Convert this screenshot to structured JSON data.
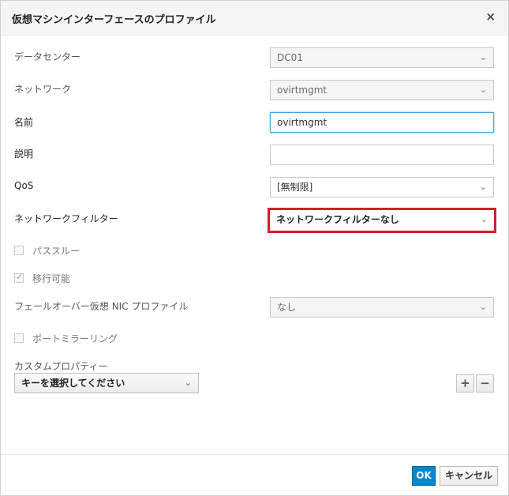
{
  "dialog": {
    "title": "仮想マシンインターフェースのプロファイル",
    "close_icon": "×"
  },
  "fields": {
    "datacenter": {
      "label": "データセンター",
      "value": "DC01"
    },
    "network": {
      "label": "ネットワーク",
      "value": "ovirtmgmt"
    },
    "name": {
      "label": "名前",
      "value": "ovirtmgmt"
    },
    "description": {
      "label": "説明",
      "value": ""
    },
    "qos": {
      "label": "QoS",
      "value": "[無制限]"
    },
    "network_filter": {
      "label": "ネットワークフィルター",
      "value": "ネットワークフィルターなし"
    },
    "passthrough": {
      "label": "パススルー",
      "checked": false
    },
    "migratable": {
      "label": "移行可能",
      "checked": true
    },
    "failover": {
      "label": "フェールオーバー仮想 NIC プロファイル",
      "value": "なし"
    },
    "port_mirroring": {
      "label": "ポートミラーリング",
      "checked": false
    },
    "custom_properties": {
      "label": "カスタムプロパティー",
      "key_placeholder": "キーを選択してください"
    }
  },
  "icons": {
    "chevron": "⌄",
    "plus": "+",
    "minus": "−"
  },
  "colors": {
    "accent": "#0088ce",
    "highlight": "#d0202a"
  },
  "footer": {
    "ok_label": "OK",
    "cancel_label": "キャンセル"
  }
}
